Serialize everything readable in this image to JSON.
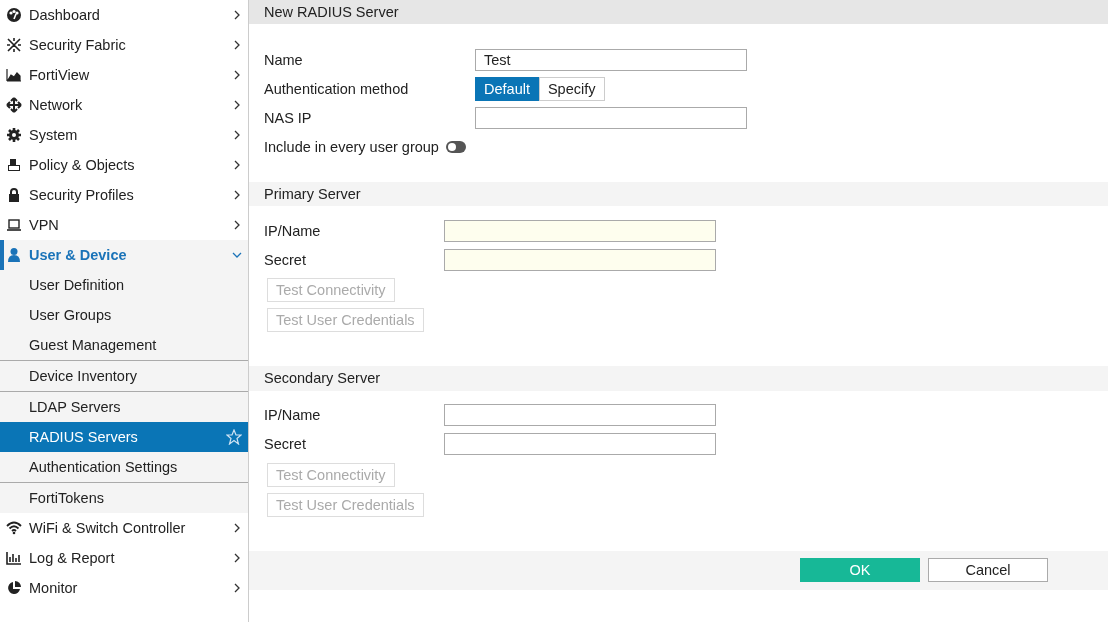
{
  "sidebar": {
    "items": [
      {
        "label": "Dashboard",
        "expanded": false,
        "selected": false
      },
      {
        "label": "Security Fabric",
        "expanded": false,
        "selected": false
      },
      {
        "label": "FortiView",
        "expanded": false,
        "selected": false
      },
      {
        "label": "Network",
        "expanded": false,
        "selected": false
      },
      {
        "label": "System",
        "expanded": false,
        "selected": false
      },
      {
        "label": "Policy & Objects",
        "expanded": false,
        "selected": false
      },
      {
        "label": "Security Profiles",
        "expanded": false,
        "selected": false
      },
      {
        "label": "VPN",
        "expanded": false,
        "selected": false
      },
      {
        "label": "User & Device",
        "expanded": true,
        "selected": true,
        "groups": [
          {
            "children": [
              {
                "label": "User Definition",
                "selected": false
              },
              {
                "label": "User Groups",
                "selected": false
              },
              {
                "label": "Guest Management",
                "selected": false
              }
            ]
          },
          {
            "children": [
              {
                "label": "Device Inventory",
                "selected": false
              }
            ]
          },
          {
            "children": [
              {
                "label": "LDAP Servers",
                "selected": false
              },
              {
                "label": "RADIUS Servers",
                "selected": true
              },
              {
                "label": "Authentication Settings",
                "selected": false
              }
            ]
          },
          {
            "children": [
              {
                "label": "FortiTokens",
                "selected": false
              }
            ]
          }
        ]
      },
      {
        "label": "WiFi & Switch Controller",
        "expanded": false,
        "selected": false
      },
      {
        "label": "Log & Report",
        "expanded": false,
        "selected": false
      },
      {
        "label": "Monitor",
        "expanded": false,
        "selected": false
      }
    ]
  },
  "page": {
    "title": "New RADIUS Server",
    "fields": [
      {
        "kind": "text",
        "label": "Name",
        "value": "Test"
      },
      {
        "kind": "segmented",
        "label": "Authentication method",
        "options": [
          {
            "label": "Default",
            "selected": true
          },
          {
            "label": "Specify",
            "selected": false
          }
        ]
      },
      {
        "kind": "text",
        "label": "NAS IP"
      },
      {
        "kind": "toggle",
        "label": "Include in every user group",
        "on": false
      }
    ],
    "sections": [
      {
        "title": "Primary Server",
        "fields": [
          {
            "label": "IP/Name",
            "required": true
          },
          {
            "label": "Secret",
            "required": true
          }
        ],
        "buttons": [
          {
            "label": "Test Connectivity",
            "disabled": true
          },
          {
            "label": "Test User Credentials",
            "disabled": true
          }
        ]
      },
      {
        "title": "Secondary Server",
        "fields": [
          {
            "label": "IP/Name",
            "required": false
          },
          {
            "label": "Secret",
            "required": false
          }
        ],
        "buttons": [
          {
            "label": "Test Connectivity",
            "disabled": true
          },
          {
            "label": "Test User Credentials",
            "disabled": true
          }
        ]
      }
    ],
    "footer": {
      "ok": "OK",
      "cancel": "Cancel"
    }
  }
}
